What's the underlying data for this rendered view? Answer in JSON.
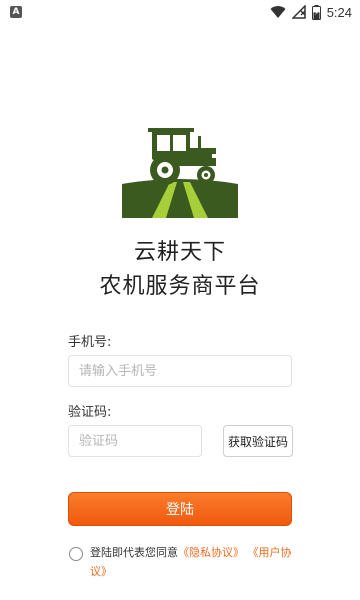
{
  "status_bar": {
    "notification_icon": "A",
    "time": "5:24",
    "icons": [
      "wifi-icon",
      "signal-icon",
      "battery-icon"
    ],
    "battery_level": 0.55
  },
  "logo": {
    "icon": "tractor-logo"
  },
  "title": {
    "line1": "云耕天下",
    "line2": "农机服务商平台"
  },
  "form": {
    "phone_label": "手机号:",
    "phone_placeholder": "请输入手机号",
    "code_label": "验证码:",
    "code_placeholder": "验证码",
    "get_code_label": "获取验证码",
    "login_label": "登陆"
  },
  "agreement": {
    "prefix": "登陆即代表您同意",
    "privacy_link": "《隐私协议》",
    "separator": " ",
    "user_link": "《用户协议》"
  },
  "colors": {
    "accent": "#f06a1d",
    "logo_dark": "#3b5a1f",
    "logo_light": "#a7cf3a"
  }
}
